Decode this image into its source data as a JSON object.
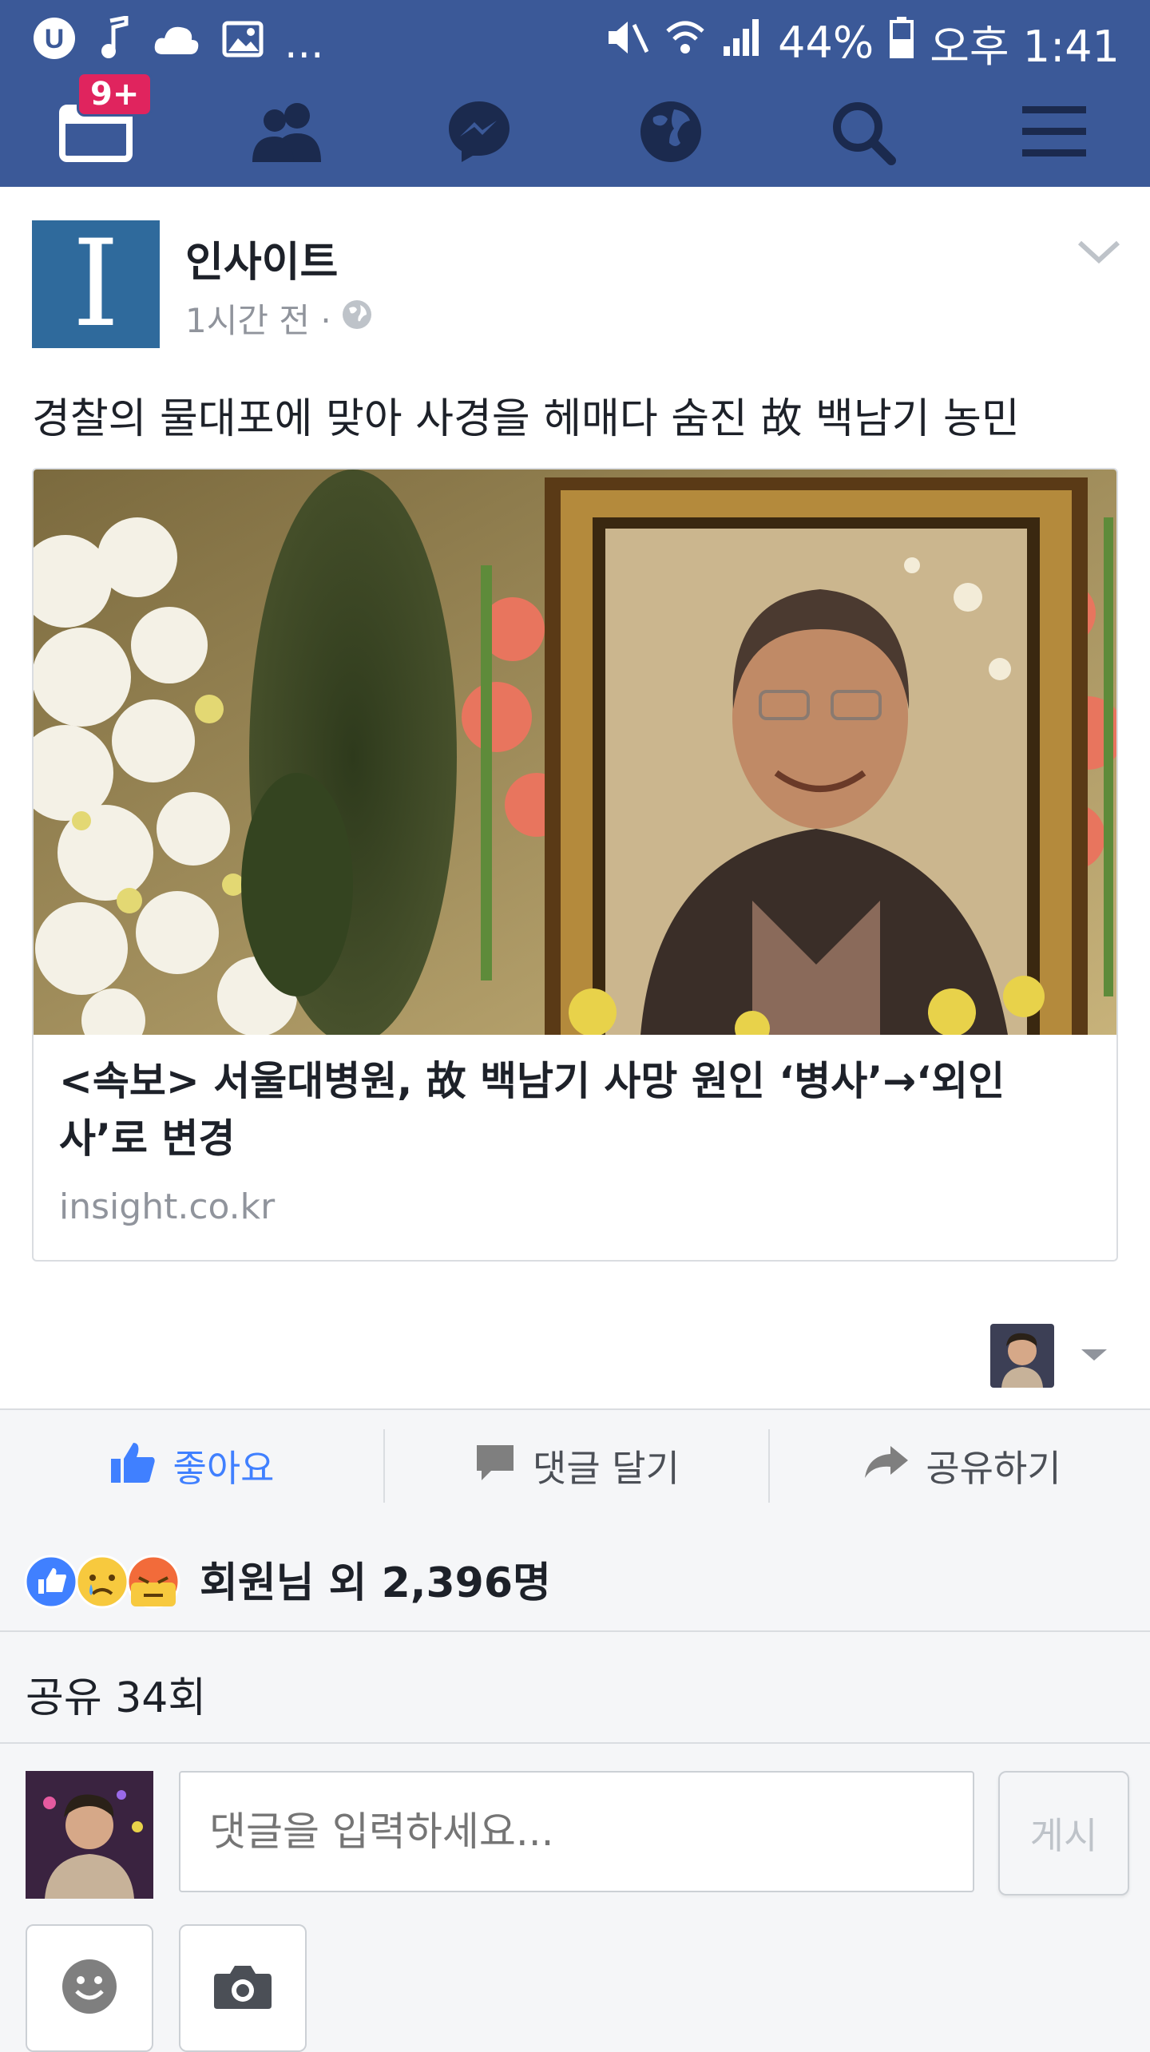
{
  "status_bar": {
    "overflow": "...",
    "battery": "44%",
    "time": "오후 1:41"
  },
  "nav": {
    "notifications_badge": "9+",
    "items": [
      {
        "icon": "news-feed-icon"
      },
      {
        "icon": "friends-icon"
      },
      {
        "icon": "messenger-icon"
      },
      {
        "icon": "globe-icon"
      },
      {
        "icon": "search-icon"
      },
      {
        "icon": "menu-icon"
      }
    ]
  },
  "post": {
    "page_logo_letter": "I",
    "page_name": "인사이트",
    "timestamp": "1시간 전 ·",
    "caption": "경찰의 물대포에 맞아 사경을 헤매다 숨진 故 백남기 농민",
    "link": {
      "title": "<속보> 서울대병원, 故 백남기 사망 원인 ‘병사’→‘외인사’로 변경",
      "domain": "insight.co.kr"
    }
  },
  "actions": {
    "like": "좋아요",
    "comment": "댓글 달기",
    "share": "공유하기"
  },
  "reactions": {
    "summary": "회원님 외 2,396명",
    "types": [
      "like",
      "sad",
      "angry"
    ]
  },
  "shares": "공유 34회",
  "composer": {
    "placeholder": "댓글을 입력하세요...",
    "post_button": "게시"
  },
  "colors": {
    "brand": "#3b5998",
    "like_blue": "#4080ff",
    "badge_red": "#e0245e"
  }
}
